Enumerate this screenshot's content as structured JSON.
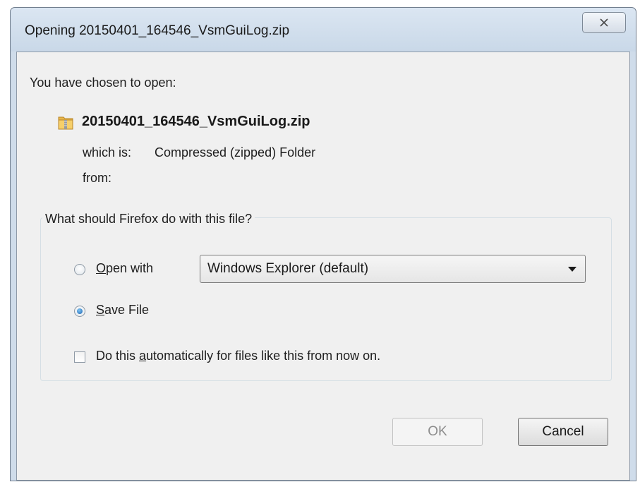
{
  "window": {
    "title": "Opening 20150401_164546_VsmGuiLog.zip"
  },
  "dialog": {
    "intro": "You have chosen to open:",
    "file_name": "20150401_164546_VsmGuiLog.zip",
    "file_icon": "zip-folder-icon",
    "which_is_label": "which is:",
    "which_is_value": "Compressed (zipped) Folder",
    "from_label": "from:"
  },
  "action_group": {
    "legend": "What should Firefox do with this file?",
    "open_with": {
      "label_mnemonic": "O",
      "label_rest": "pen with",
      "selected": false,
      "app": "Windows Explorer (default)"
    },
    "save_file": {
      "label_mnemonic": "S",
      "label_rest": "ave File",
      "selected": true
    },
    "auto": {
      "label_pre": "Do this ",
      "label_mnemonic": "a",
      "label_rest": "utomatically for files like this from now on.",
      "checked": false
    }
  },
  "buttons": {
    "ok": "OK",
    "cancel": "Cancel"
  },
  "colors": {
    "frame": "#cfdcea",
    "content_bg": "#f0f0f0",
    "radio_selected": "#1a63b0"
  }
}
